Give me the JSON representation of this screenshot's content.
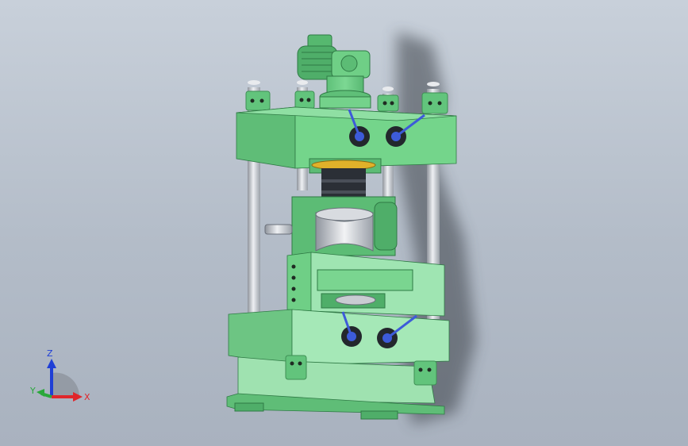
{
  "viewport": {
    "background_top": "#c8d0da",
    "background_bottom": "#a9b2bf"
  },
  "model": {
    "body_color": "#6fcf86",
    "body_dark": "#4fae69",
    "body_light": "#9ee3b0",
    "steel_color": "#c9ccd2",
    "dark_part": "#2b2f36",
    "accent_blue": "#3d5bd9",
    "accent_yellow": "#e0b12a"
  },
  "triad": {
    "x_label": "X",
    "y_label": "Y",
    "z_label": "Z",
    "x_color": "#e0262b",
    "y_color": "#2aa83a",
    "z_color": "#1f3fd6"
  }
}
